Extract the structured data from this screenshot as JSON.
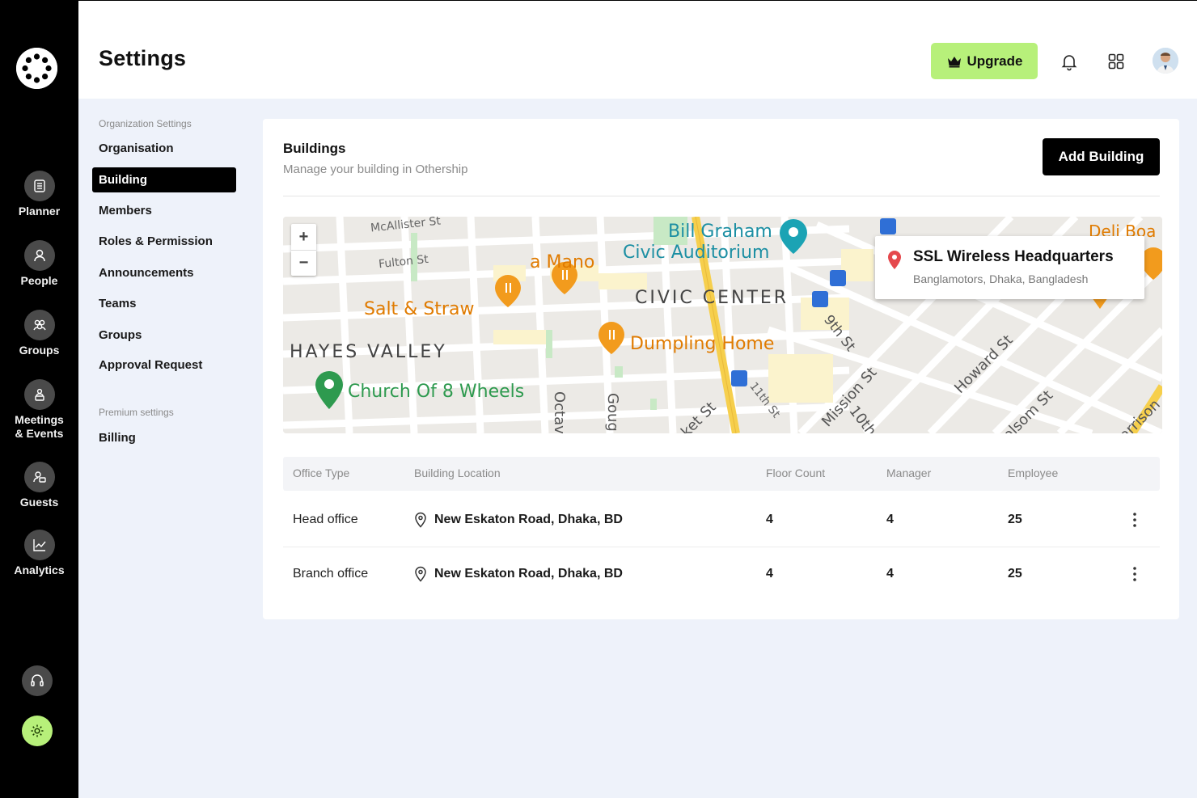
{
  "nav": {
    "items": [
      {
        "label": "Planner",
        "icon": "planner-icon"
      },
      {
        "label": "People",
        "icon": "people-icon"
      },
      {
        "label": "Groups",
        "icon": "groups-icon"
      },
      {
        "label": "Meetings\n& Events",
        "label1": "Meetings",
        "label2": "& Events",
        "icon": "meetings-icon"
      },
      {
        "label": "Guests",
        "icon": "guests-icon"
      },
      {
        "label": "Analytics",
        "icon": "analytics-icon"
      }
    ],
    "support_icon": "headset-icon",
    "settings_icon": "gear-icon",
    "settings_color": "#b7f07a"
  },
  "header": {
    "title": "Settings",
    "upgrade_label": "Upgrade",
    "upgrade_color": "#b7f07a"
  },
  "subnav": {
    "section1": "Organization Settings",
    "items": [
      "Organisation",
      "Building",
      "Members",
      "Roles & Permission",
      "Announcements",
      "Teams",
      "Groups",
      "Approval Request"
    ],
    "active": "Building",
    "section2": "Premium settings",
    "premium_items": [
      "Billing"
    ]
  },
  "buildings": {
    "title": "Buildings",
    "subtitle": "Manage your building in Othership",
    "add_label": "Add Building"
  },
  "map": {
    "zoom_in": "+",
    "zoom_out": "−",
    "labels": {
      "mcallister": "McAllister St",
      "fulton": "Fulton St",
      "amano": "a Mano",
      "bill_graham_1": "Bill Graham",
      "bill_graham_2": "Civic Auditorium",
      "salt_straw": "Salt & Straw",
      "civic_center": "CIVIC CENTER",
      "ninth": "9th St",
      "hayes_valley": "HAYES VALLEY",
      "dumpling": "Dumpling Home",
      "howard": "Howard St",
      "mission": "Mission St",
      "tenth": "10th S",
      "eleventh": "11th St",
      "church": "Church Of 8 Wheels",
      "octavia": "Octav",
      "gough": "Goug",
      "market": "ket St",
      "folsom": "olsom St",
      "harrison": "arrison",
      "deli": "Deli Boa"
    },
    "popup": {
      "title": "SSL Wireless Headquarters",
      "subtitle": "Banglamotors, Dhaka, Bangladesh"
    }
  },
  "table": {
    "headers": [
      "Office Type",
      "Building Location",
      "Floor Count",
      "Manager",
      "Employee"
    ],
    "rows": [
      {
        "office_type": "Head office",
        "location": "New Eskaton Road, Dhaka, BD",
        "floor_count": "4",
        "manager": "4",
        "employee": "25"
      },
      {
        "office_type": "Branch office",
        "location": "New Eskaton Road, Dhaka, BD",
        "floor_count": "4",
        "manager": "4",
        "employee": "25"
      }
    ]
  }
}
